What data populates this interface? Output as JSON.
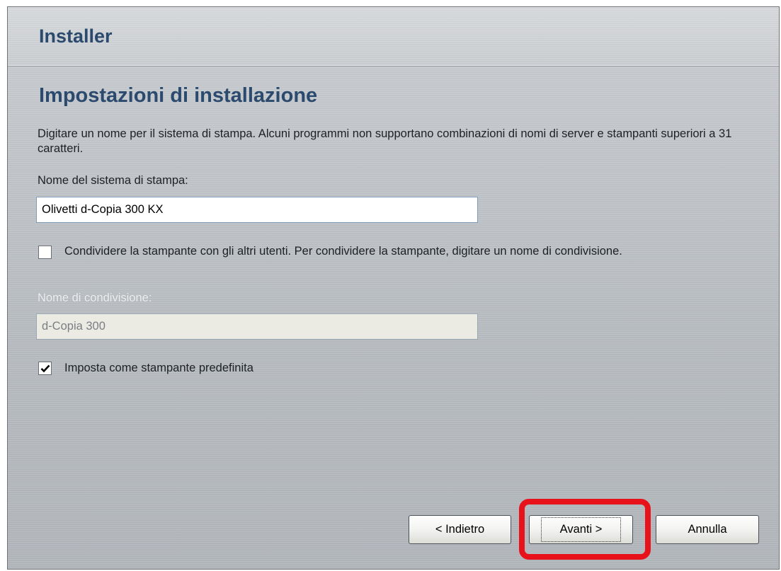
{
  "window": {
    "title": "Installer"
  },
  "page": {
    "heading": "Impostazioni di installazione",
    "description": "Digitare un nome per il sistema di stampa. Alcuni programmi non supportano combinazioni di nomi di server e stampanti superiori a 31 caratteri.",
    "printer_name": {
      "label": "Nome del sistema di stampa:",
      "value": "Olivetti d-Copia 300 KX"
    },
    "share_checkbox": {
      "checked": false,
      "label": "Condividere la stampante con gli altri utenti. Per condividere la stampante, digitare un nome di condivisione."
    },
    "share_name": {
      "label": "Nome di condivisione:",
      "value": "d-Copia 300",
      "disabled": true
    },
    "default_checkbox": {
      "checked": true,
      "label": "Imposta come stampante predefinita"
    }
  },
  "buttons": {
    "back": "< Indietro",
    "next": "Avanti >",
    "cancel": "Annulla"
  },
  "colors": {
    "heading": "#2b4a6d",
    "highlight": "#e8131a"
  }
}
